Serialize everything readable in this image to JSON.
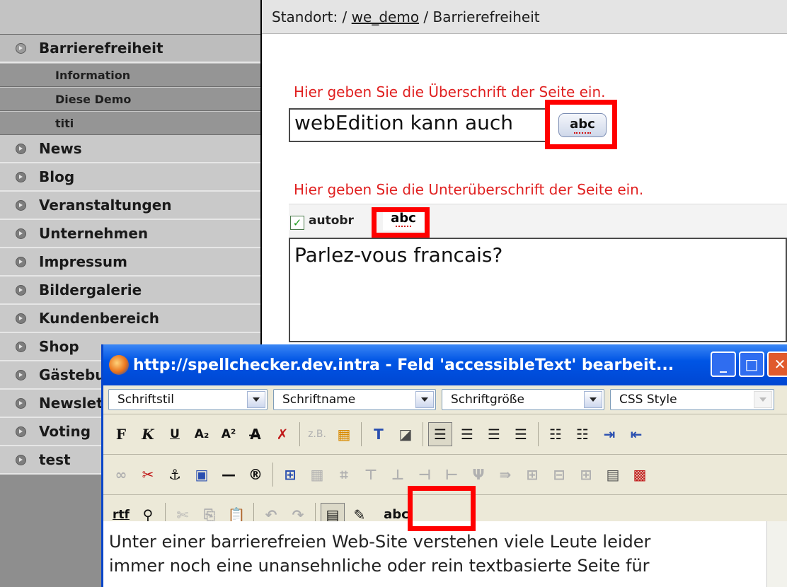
{
  "header": {
    "prefix": "Standort: /",
    "link": "we_demo",
    "suffix": "/ Barrierefreiheit"
  },
  "sidebar": {
    "active": "Barrierefreiheit",
    "subitems": [
      "Information",
      "Diese Demo",
      "titi"
    ],
    "items": [
      "News",
      "Blog",
      "Veranstaltungen",
      "Unternehmen",
      "Impressum",
      "Bildergalerie",
      "Kundenbereich",
      "Shop",
      "Gästebuch",
      "Newsletter",
      "Voting",
      "test"
    ]
  },
  "main": {
    "hint_title": "Hier geben Sie die Überschrift der Seite ein.",
    "title_value": "webEdition kann auch",
    "hint_subtitle": "Hier geben Sie die Unterüberschrift der Seite ein.",
    "autobr_label": "autobr",
    "subtitle_value": "Parlez-vous francais?",
    "spell_label": "abc"
  },
  "popup": {
    "title": "http://spellchecker.dev.intra - Feld 'accessibleText' bearbeit...",
    "selects": [
      "Schriftstil",
      "Schriftname",
      "Schriftgröße",
      "CSS Style"
    ],
    "content_line1": "Unter einer barrierefreien Web-Site verstehen viele Leute leider",
    "content_line2": "immer noch eine unansehnliche oder rein textbasierte Seite für",
    "rtf_label": "rtf",
    "zb_label": "z.B."
  },
  "colors": {
    "highlight": "#ff0000",
    "hint_text": "#e02020",
    "titlebar": "#0055e5"
  }
}
